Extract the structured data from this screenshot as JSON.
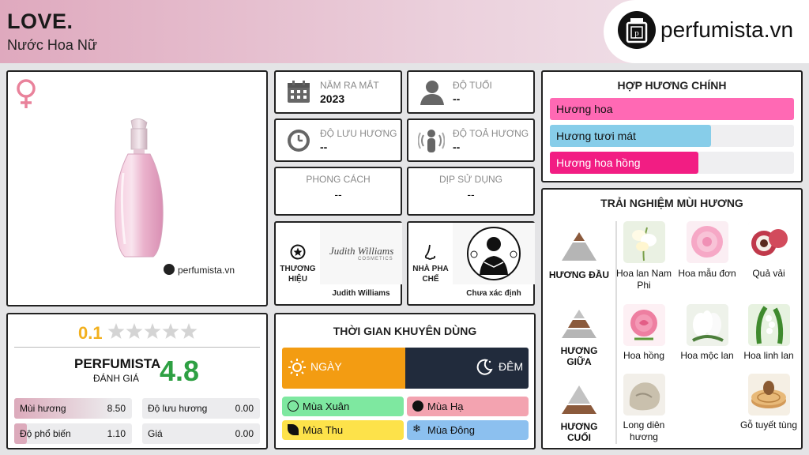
{
  "header": {
    "title": "LOVE.",
    "subtitle": "Nước Hoa Nữ",
    "brand_site": "perfumista.vn"
  },
  "product": {
    "gender_icon": "female-symbol-icon",
    "watermark": "perfumista.vn"
  },
  "info": {
    "release_year_label": "NĂM RA MẮT",
    "release_year_value": "2023",
    "age_label": "ĐỘ TUỔI",
    "age_value": "--",
    "longevity_label": "ĐỘ LƯU HƯƠNG",
    "longevity_value": "--",
    "sillage_label": "ĐỘ TOẢ HƯƠNG",
    "sillage_value": "--",
    "style_label": "PHONG CÁCH",
    "style_value": "--",
    "occasion_label": "DỊP SỬ DỤNG",
    "occasion_value": "--",
    "brand_label_1": "THƯƠNG",
    "brand_label_2": "HIỆU",
    "brand_name": "Judith Williams",
    "brand_logo_text": "Judith Williams",
    "brand_logo_sub": "COSMETICS",
    "perfumer_label_1": "NHÀ PHA",
    "perfumer_label_2": "CHẾ",
    "perfumer_name": "Chưa xác định"
  },
  "accords": {
    "title": "HỢP HƯƠNG CHÍNH",
    "items": [
      {
        "label": "Hương hoa",
        "percent": 100,
        "color": "#ff69b4"
      },
      {
        "label": "Hương tươi mát",
        "percent": 66,
        "color": "#87cde9"
      },
      {
        "label": "Hương hoa hồng",
        "percent": 61,
        "color": "#f21d83"
      }
    ]
  },
  "notes": {
    "title": "TRẢI NGHIỆM MÙI HƯƠNG",
    "top_label": "HƯƠNG ĐẦU",
    "middle_label": "HƯƠNG GIỮA",
    "base_label": "HƯƠNG CUỐI",
    "top": [
      "Hoa lan Nam Phi",
      "Hoa mẫu đơn",
      "Quả vải"
    ],
    "middle": [
      "Hoa hồng",
      "Hoa mộc lan",
      "Hoa linh lan"
    ],
    "base": [
      "Long diên hương",
      "Gỗ tuyết tùng"
    ]
  },
  "ratings": {
    "user_score": "0.1",
    "user_stars": 0,
    "perfumista_label": "PERFUMISTA",
    "perfumista_sub": "ĐÁNH GIÁ",
    "perfumista_score": "4.8",
    "stats": [
      {
        "key": "Mùi hương",
        "value": "8.50",
        "fill": 0.85
      },
      {
        "key": "Độ lưu hương",
        "value": "0.00",
        "fill": 0
      },
      {
        "key": "Độ phổ biến",
        "value": "1.10",
        "fill": 0.11
      },
      {
        "key": "Giá",
        "value": "0.00",
        "fill": 0
      }
    ]
  },
  "usage": {
    "title": "THỜI GIAN KHUYÊN DÙNG",
    "day_label": "NGÀY",
    "night_label": "ĐÊM",
    "seasons": {
      "spring": "Mùa Xuân",
      "summer": "Mùa Hạ",
      "autumn": "Mùa Thu",
      "winter": "Mùa Đông"
    },
    "colors": {
      "day": "#f39c12",
      "night": "#212b3c",
      "spring": "#7ee8a0",
      "summer": "#f3a3b0",
      "autumn": "#fde24a",
      "winter": "#8cc0ef"
    }
  }
}
